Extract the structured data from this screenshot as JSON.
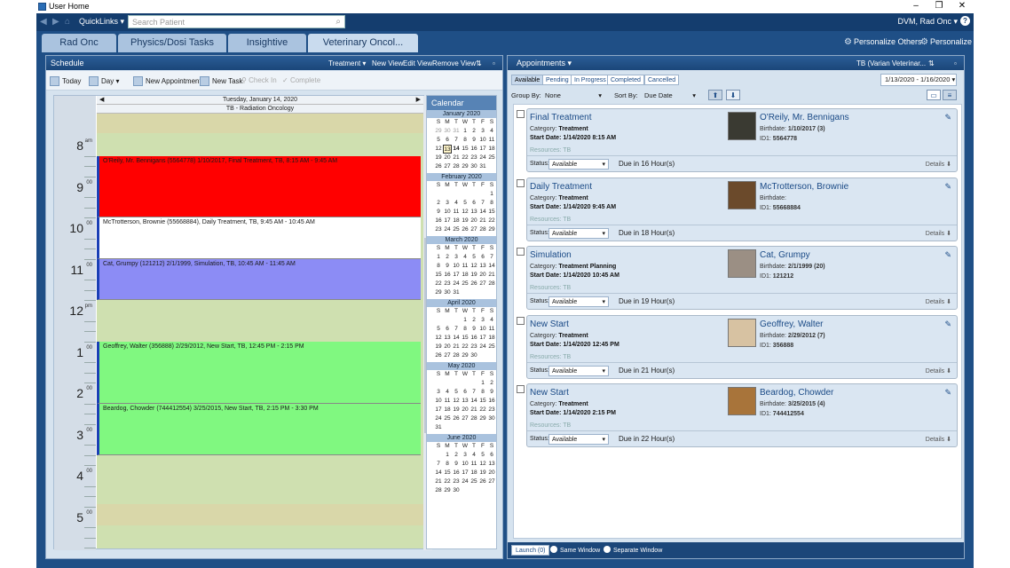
{
  "window": {
    "title": "User Home"
  },
  "toolbar": {
    "quicklinks": "QuickLinks ▾",
    "search_placeholder": "Search Patient",
    "user": "DVM, Rad Onc ▾"
  },
  "tabs": [
    "Rad Onc",
    "Physics/Dosi Tasks",
    "Insightive",
    "Veterinary Oncol..."
  ],
  "personalize": {
    "others": "Personalize Others",
    "self": "Personalize"
  },
  "schedule": {
    "title": "Schedule",
    "links": [
      "Treatment ▾",
      "New View",
      "Edit View",
      "Remove View"
    ],
    "tools": {
      "today": "Today",
      "day": "Day ▾",
      "new_appt": "New Appointment",
      "new_task": "New Task",
      "check_in": "Check In",
      "complete": "Complete"
    },
    "date_header": "Tuesday, January 14, 2020",
    "resource_header": "TB - Radiation Oncology",
    "hours": [
      {
        "n": "8",
        "m": "am"
      },
      {
        "n": "9",
        "m": "00"
      },
      {
        "n": "10",
        "m": "00"
      },
      {
        "n": "11",
        "m": "00"
      },
      {
        "n": "12",
        "m": "pm"
      },
      {
        "n": "1",
        "m": "00"
      },
      {
        "n": "2",
        "m": "00"
      },
      {
        "n": "3",
        "m": "00"
      },
      {
        "n": "4",
        "m": "00"
      },
      {
        "n": "5",
        "m": "00"
      }
    ],
    "appointments": [
      {
        "text": "O'Reily, Mr. Bennigans (5564778) 1/10/2017, Final Treatment, TB, 8:15 AM - 9:45 AM",
        "color": "#ff0000"
      },
      {
        "text": "McTrotterson, Brownie (55668884), Daily Treatment, TB, 9:45 AM - 10:45 AM",
        "color": "#ffffff"
      },
      {
        "text": "Cat, Grumpy (121212) 2/1/1999, Simulation, TB, 10:45 AM - 11:45 AM",
        "color": "#8c8cf5"
      },
      {
        "text": "Geoffrey, Walter (356888) 2/29/2012, New Start, TB, 12:45 PM - 2:15 PM",
        "color": "#80f880"
      },
      {
        "text": "Beardog, Chowder (744412554) 3/25/2015, New Start, TB, 2:15 PM - 3:30 PM",
        "color": "#80f880"
      }
    ]
  },
  "calendar": {
    "title": "Calendar",
    "weekdays": [
      "S",
      "M",
      "T",
      "W",
      "T",
      "F",
      "S"
    ],
    "months": [
      {
        "name": "January 2020",
        "days": [
          "29",
          "30",
          "31",
          "1",
          "2",
          "3",
          "4",
          "5",
          "6",
          "7",
          "8",
          "9",
          "10",
          "11",
          "12",
          "13",
          "14",
          "15",
          "16",
          "17",
          "18",
          "19",
          "20",
          "21",
          "22",
          "23",
          "24",
          "25",
          "26",
          "27",
          "28",
          "29",
          "30",
          "31"
        ],
        "lead": 3,
        "selected": "13",
        "bold": "14"
      },
      {
        "name": "February 2020",
        "days": [
          "1",
          "2",
          "3",
          "4",
          "5",
          "6",
          "7",
          "8",
          "9",
          "10",
          "11",
          "12",
          "13",
          "14",
          "15",
          "16",
          "17",
          "18",
          "19",
          "20",
          "21",
          "22",
          "23",
          "24",
          "25",
          "26",
          "27",
          "28",
          "29"
        ],
        "lead": 6
      },
      {
        "name": "March 2020",
        "days": [
          "1",
          "2",
          "3",
          "4",
          "5",
          "6",
          "7",
          "8",
          "9",
          "10",
          "11",
          "12",
          "13",
          "14",
          "15",
          "16",
          "17",
          "18",
          "19",
          "20",
          "21",
          "22",
          "23",
          "24",
          "25",
          "26",
          "27",
          "28",
          "29",
          "30",
          "31"
        ],
        "lead": 0
      },
      {
        "name": "April 2020",
        "days": [
          "1",
          "2",
          "3",
          "4",
          "5",
          "6",
          "7",
          "8",
          "9",
          "10",
          "11",
          "12",
          "13",
          "14",
          "15",
          "16",
          "17",
          "18",
          "19",
          "20",
          "21",
          "22",
          "23",
          "24",
          "25",
          "26",
          "27",
          "28",
          "29",
          "30"
        ],
        "lead": 3
      },
      {
        "name": "May 2020",
        "days": [
          "1",
          "2",
          "3",
          "4",
          "5",
          "6",
          "7",
          "8",
          "9",
          "10",
          "11",
          "12",
          "13",
          "14",
          "15",
          "16",
          "17",
          "18",
          "19",
          "20",
          "21",
          "22",
          "23",
          "24",
          "25",
          "26",
          "27",
          "28",
          "29",
          "30",
          "31"
        ],
        "lead": 5
      },
      {
        "name": "June 2020",
        "days": [
          "1",
          "2",
          "3",
          "4",
          "5",
          "6",
          "7",
          "8",
          "9",
          "10",
          "11",
          "12",
          "13",
          "14",
          "15",
          "16",
          "17",
          "18",
          "19",
          "20",
          "21",
          "22",
          "23",
          "24",
          "25",
          "26",
          "27",
          "28",
          "29",
          "30"
        ],
        "lead": 1
      }
    ]
  },
  "appointments_panel": {
    "title": "Appointments ▾",
    "machine": "TB (Varian Veterinar...",
    "filters": [
      "Available",
      "Pending",
      "In Progress",
      "Completed",
      "Cancelled"
    ],
    "date_range": "1/13/2020 - 1/16/2020 ▾",
    "group_by_label": "Group By:",
    "group_by_value": "None",
    "sort_by_label": "Sort By:",
    "sort_by_value": "Due Date",
    "labels": {
      "category": "Category:",
      "start": "Start Date:",
      "resources": "Resources:",
      "birthdate": "Birthdate:",
      "id1": "ID1:",
      "status": "Status:",
      "details": "Details"
    },
    "items": [
      {
        "title": "Final Treatment",
        "category": "Treatment",
        "start": "1/14/2020 8:15 AM",
        "resources": "TB",
        "patient": "O'Reily, Mr. Bennigans",
        "birthdate": "1/10/2017  (3)",
        "id1": "5564778",
        "status": "Available",
        "due": "Due in 16 Hour(s)"
      },
      {
        "title": "Daily Treatment",
        "category": "Treatment",
        "start": "1/14/2020 9:45 AM",
        "resources": "TB",
        "patient": "McTrotterson, Brownie",
        "birthdate": "",
        "id1": "55668884",
        "status": "Available",
        "due": "Due in 18 Hour(s)"
      },
      {
        "title": "Simulation",
        "category": "Treatment Planning",
        "start": "1/14/2020 10:45 AM",
        "resources": "TB",
        "patient": "Cat, Grumpy",
        "birthdate": "2/1/1999  (20)",
        "id1": "121212",
        "status": "Available",
        "due": "Due in 19 Hour(s)"
      },
      {
        "title": "New Start",
        "category": "Treatment",
        "start": "1/14/2020 12:45 PM",
        "resources": "TB",
        "patient": "Geoffrey, Walter",
        "birthdate": "2/29/2012  (7)",
        "id1": "356888",
        "status": "Available",
        "due": "Due in 21 Hour(s)"
      },
      {
        "title": "New Start",
        "category": "Treatment",
        "start": "1/14/2020 2:15 PM",
        "resources": "TB",
        "patient": "Beardog, Chowder",
        "birthdate": "3/25/2015  (4)",
        "id1": "744412554",
        "status": "Available",
        "due": "Due in 22 Hour(s)"
      }
    ],
    "launch": "Launch (0)",
    "same_window": "Same Window",
    "separate_window": "Separate Window"
  }
}
